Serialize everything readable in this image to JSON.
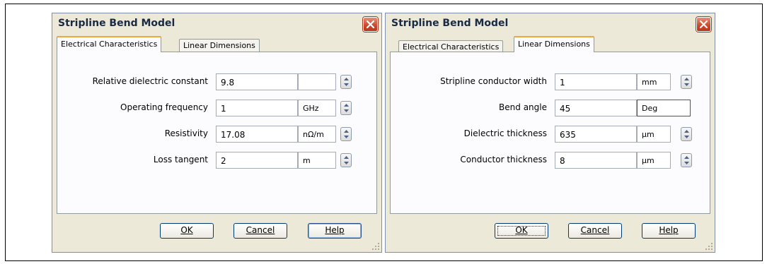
{
  "colors": {
    "dialog_bg": "#ece9d8",
    "active_tab_accent": "#f2a63a",
    "close_button": "#c9472b"
  },
  "dialogs": [
    {
      "title": "Stripline Bend Model",
      "tabs": [
        {
          "label": "Electrical Characteristics",
          "active": true
        },
        {
          "label": "Linear Dimensions",
          "active": false
        }
      ],
      "rows": [
        {
          "label": "Relative dielectric constant",
          "value": "9.8",
          "unit": ""
        },
        {
          "label": "Operating frequency",
          "value": "1",
          "unit": "GHz"
        },
        {
          "label": "Resistivity",
          "value": "17.08",
          "unit": "nΩ/m"
        },
        {
          "label": "Loss tangent",
          "value": "2",
          "unit": "m"
        }
      ],
      "buttons": {
        "ok": "OK",
        "cancel": "Cancel",
        "help": "Help"
      }
    },
    {
      "title": "Stripline Bend Model",
      "tabs": [
        {
          "label": "Electrical Characteristics",
          "active": false
        },
        {
          "label": "Linear Dimensions",
          "active": true
        }
      ],
      "rows": [
        {
          "label": "Stripline conductor width",
          "value": "1",
          "unit": "mm"
        },
        {
          "label": "Bend angle",
          "value": "45",
          "unit": "Deg"
        },
        {
          "label": "Dielectric thickness",
          "value": "635",
          "unit": "µm"
        },
        {
          "label": "Conductor thickness",
          "value": "8",
          "unit": "µm"
        }
      ],
      "buttons": {
        "ok": "OK",
        "cancel": "Cancel",
        "help": "Help"
      }
    }
  ]
}
